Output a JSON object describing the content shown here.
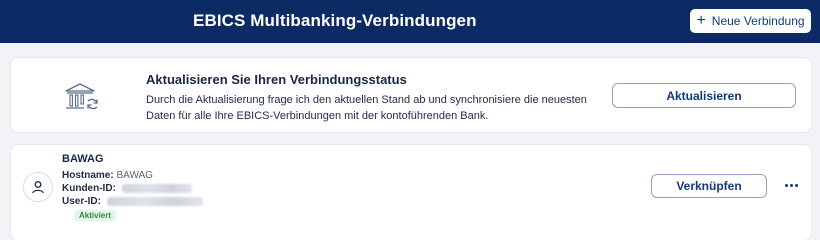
{
  "header": {
    "title": "EBICS Multibanking-Verbindungen",
    "new_button_label": "Neue Verbindung",
    "new_button_icon": "plus-icon"
  },
  "status_card": {
    "icon": "bank-refresh-icon",
    "title": "Aktualisieren Sie Ihren Verbindungsstatus",
    "description": "Durch die Aktualisierung frage ich den aktuellen Stand ab und synchronisiere die neuesten Daten für alle Ihre EBICS-Verbindungen mit der kontoführenden Bank.",
    "button_label": "Aktualisieren"
  },
  "connection": {
    "name": "BAWAG",
    "icon": "user-icon",
    "hostname_label": "Hostname:",
    "hostname_value": "BAWAG",
    "kunden_id_label": "Kunden-ID:",
    "user_id_label": "User-ID:",
    "status_badge": "Aktiviert",
    "link_button_label": "Verknüpfen",
    "more_icon": "more-horizontal-icon"
  },
  "colors": {
    "header_bg": "#0c2a63",
    "accent": "#123a7a",
    "badge_bg": "#e4f6e8",
    "badge_text": "#2e8a45"
  }
}
